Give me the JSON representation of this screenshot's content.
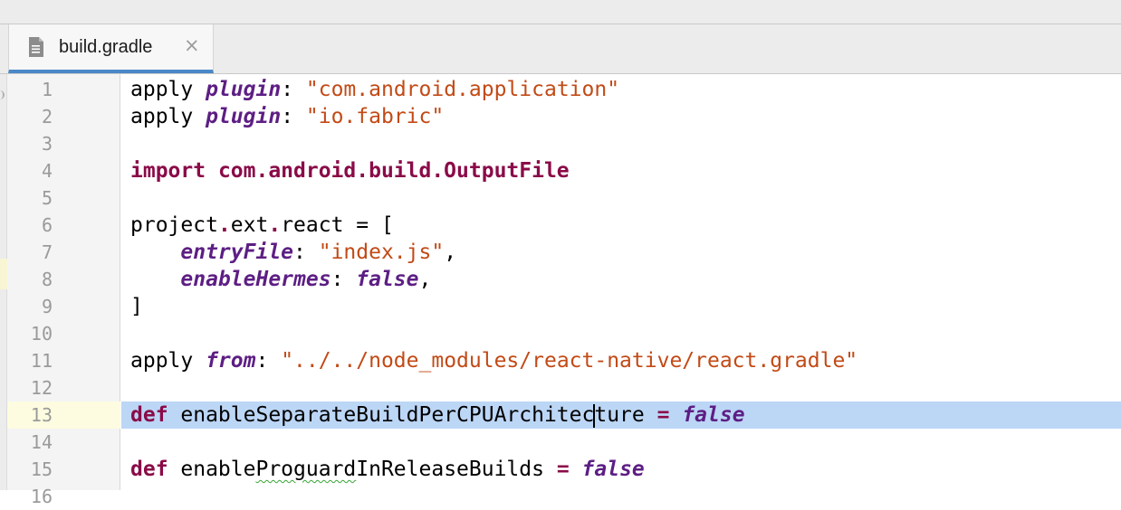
{
  "tab": {
    "title": "build.gradle",
    "close_icon": "×",
    "file_icon": "file-document-icon"
  },
  "colors": {
    "keyword": "#8a0b48",
    "property": "#5d1e84",
    "string": "#c24a16",
    "selection": "#bcd6f6",
    "current_line_gutter": "#fdfce0",
    "tab_underline": "#4a88c7"
  },
  "editor": {
    "cursor_line": 13,
    "lines": [
      {
        "n": "1",
        "tokens": [
          {
            "t": "apply ",
            "c": "plain"
          },
          {
            "t": "plugin",
            "c": "kwi"
          },
          {
            "t": ": ",
            "c": "plain"
          },
          {
            "t": "\"com.android.application\"",
            "c": "str"
          }
        ]
      },
      {
        "n": "2",
        "tokens": [
          {
            "t": "apply ",
            "c": "plain"
          },
          {
            "t": "plugin",
            "c": "kwi"
          },
          {
            "t": ": ",
            "c": "plain"
          },
          {
            "t": "\"io.fabric\"",
            "c": "str"
          }
        ]
      },
      {
        "n": "3",
        "tokens": []
      },
      {
        "n": "4",
        "tokens": [
          {
            "t": "import ",
            "c": "kw"
          },
          {
            "t": "com.android.build.OutputFile",
            "c": "kw"
          }
        ]
      },
      {
        "n": "5",
        "tokens": []
      },
      {
        "n": "6",
        "tokens": [
          {
            "t": "project",
            "c": "plain"
          },
          {
            "t": ".",
            "c": "dot"
          },
          {
            "t": "ext",
            "c": "plain"
          },
          {
            "t": ".",
            "c": "dot"
          },
          {
            "t": "react = [",
            "c": "plain"
          }
        ]
      },
      {
        "n": "7",
        "tokens": [
          {
            "t": "    ",
            "c": "plain"
          },
          {
            "t": "entryFile",
            "c": "kwi"
          },
          {
            "t": ": ",
            "c": "plain"
          },
          {
            "t": "\"index.js\"",
            "c": "str"
          },
          {
            "t": ",",
            "c": "plain"
          }
        ]
      },
      {
        "n": "8",
        "tokens": [
          {
            "t": "    ",
            "c": "plain"
          },
          {
            "t": "enableHermes",
            "c": "kwi"
          },
          {
            "t": ": ",
            "c": "plain"
          },
          {
            "t": "false",
            "c": "kwi"
          },
          {
            "t": ",",
            "c": "plain"
          }
        ]
      },
      {
        "n": "9",
        "tokens": [
          {
            "t": "]",
            "c": "plain"
          }
        ]
      },
      {
        "n": "10",
        "tokens": []
      },
      {
        "n": "11",
        "tokens": [
          {
            "t": "apply ",
            "c": "plain"
          },
          {
            "t": "from",
            "c": "kwi"
          },
          {
            "t": ": ",
            "c": "plain"
          },
          {
            "t": "\"../../node_modules/react-native/react.gradle\"",
            "c": "str"
          }
        ]
      },
      {
        "n": "12",
        "tokens": []
      },
      {
        "n": "13",
        "tokens": [
          {
            "t": "def ",
            "c": "kw"
          },
          {
            "t": "enableSeparateBuildPerCPUArchitec",
            "c": "plain"
          },
          {
            "t": "",
            "c": "caret"
          },
          {
            "t": "ture ",
            "c": "plain"
          },
          {
            "t": "=",
            "c": "kw"
          },
          {
            "t": " ",
            "c": "plain"
          },
          {
            "t": "false",
            "c": "kwi"
          }
        ]
      },
      {
        "n": "14",
        "tokens": []
      },
      {
        "n": "15",
        "tokens": [
          {
            "t": "def ",
            "c": "kw"
          },
          {
            "t": "enable",
            "c": "plain"
          },
          {
            "t": "Proguard",
            "c": "squiggle"
          },
          {
            "t": "InReleaseBuilds ",
            "c": "plain"
          },
          {
            "t": "=",
            "c": "kw"
          },
          {
            "t": " ",
            "c": "plain"
          },
          {
            "t": "false",
            "c": "kwi"
          }
        ]
      },
      {
        "n": "16",
        "tokens": []
      }
    ]
  }
}
